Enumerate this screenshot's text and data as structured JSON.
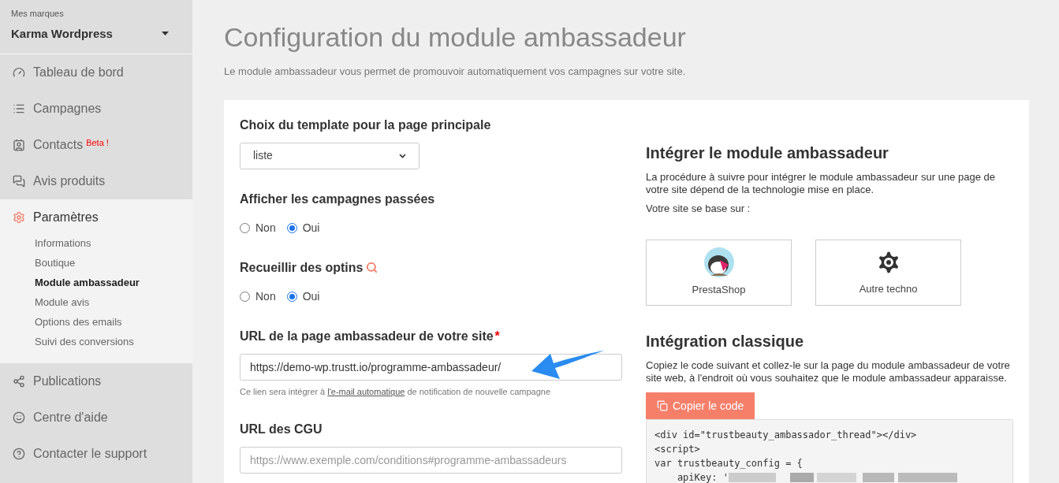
{
  "sidebar": {
    "brand_label": "Mes marques",
    "brand_name": "Karma Wordpress",
    "nav": [
      {
        "label": "Tableau de bord",
        "selected": false
      },
      {
        "label": "Campagnes",
        "selected": false
      },
      {
        "label": "Contacts",
        "badge": "Beta !",
        "selected": false
      },
      {
        "label": "Avis produits",
        "selected": false
      },
      {
        "label": "Paramètres",
        "selected": true,
        "children": [
          {
            "label": "Informations",
            "selected": false
          },
          {
            "label": "Boutique",
            "selected": false
          },
          {
            "label": "Module ambassadeur",
            "selected": true
          },
          {
            "label": "Module avis",
            "selected": false
          },
          {
            "label": "Options des emails",
            "selected": false
          },
          {
            "label": "Suivi des conversions",
            "selected": false
          }
        ]
      },
      {
        "label": "Publications",
        "selected": false
      },
      {
        "label": "Centre d'aide",
        "selected": false
      },
      {
        "label": "Contacter le support",
        "selected": false
      }
    ]
  },
  "page": {
    "title": "Configuration du module ambassadeur",
    "subtitle": "Le module ambassadeur vous permet de promouvoir automatiquement vos campagnes sur votre site."
  },
  "form": [
    {
      "kind": "select",
      "label": "Choix du template pour la page principale",
      "value": "liste"
    },
    {
      "kind": "radio",
      "label": "Afficher les campagnes passées",
      "options": [
        {
          "label": "Non",
          "selected": false
        },
        {
          "label": "Oui",
          "selected": true
        }
      ]
    },
    {
      "kind": "radio",
      "label": "Recueillir des optins",
      "search_icon": true,
      "options": [
        {
          "label": "Non",
          "selected": false
        },
        {
          "label": "Oui",
          "selected": true
        }
      ]
    },
    {
      "kind": "text",
      "label": "URL de la page ambassadeur de votre site",
      "required_mark": "*",
      "value": "https://demo-wp.trustt.io/programme-ambassadeur/",
      "help": "Ce lien sera intégrer à ",
      "help_link": "l'e-mail automatique",
      "help_after": " de notification de nouvelle campagne",
      "arrow": true
    },
    {
      "kind": "text",
      "label": "URL des CGU",
      "placeholder": "https://www.exemple.com/conditions#programme-ambassadeurs"
    }
  ],
  "integrate": {
    "title": "Intégrer le module ambassadeur",
    "description": "La procédure à suivre pour intégrer le module ambassadeur sur une page de votre site dépend de la technologie mise en place.",
    "prompt": "Votre site se base sur :",
    "choices": [
      {
        "kind": "prestashop",
        "label": "PrestaShop"
      },
      {
        "kind": "other",
        "label": "Autre techno"
      }
    ]
  },
  "classic": {
    "title": "Intégration classique",
    "description": "Copiez le code suivant et collez-le sur la page du module ambassadeur de votre site web, à l'endroit où vous souhaitez que le module ambassadeur apparaisse.",
    "copy_button": "Copier le code",
    "code": [
      {
        "text": "<div id=\"trustbeauty_ambassador_thread\"></div>"
      },
      {
        "text": "<script>"
      },
      {
        "text": "var trustbeauty_config = {"
      },
      {
        "text": "    apiKey: '",
        "redacted": true
      }
    ]
  }
}
